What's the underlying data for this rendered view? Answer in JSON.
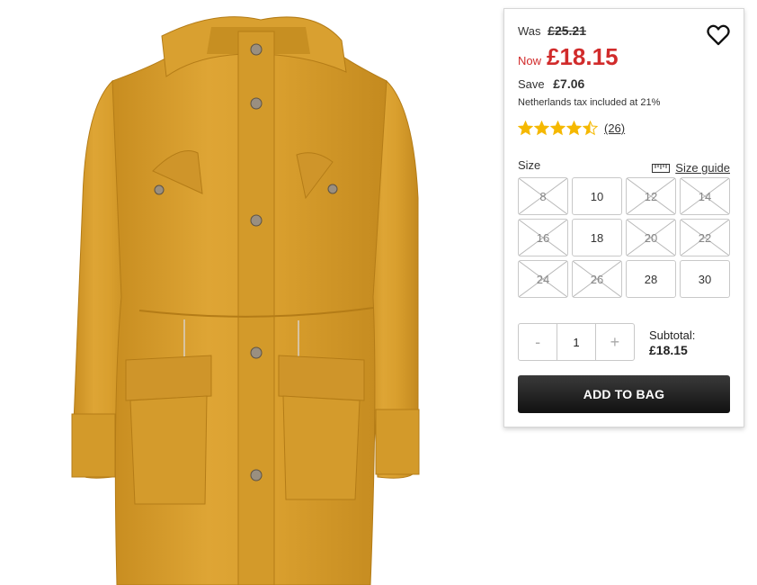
{
  "product": {
    "image_alt": "Mustard yellow hooded parka coat",
    "colors": {
      "coat": "#d79f2c",
      "coat_dark": "#b7801b",
      "coat_light": "#e8b84a"
    }
  },
  "price": {
    "was_label": "Was",
    "was_value": "£25.21",
    "now_label": "Now",
    "now_value": "£18.15",
    "save_label": "Save",
    "save_value": "£7.06",
    "tax_note": "Netherlands tax included at 21%",
    "accent": "#d12b2b"
  },
  "rating": {
    "stars": 4.5,
    "max": 5,
    "count_text": "(26)",
    "star_color": "#f5b800"
  },
  "size": {
    "label": "Size",
    "guide_label": "Size guide",
    "options": [
      {
        "label": "8",
        "available": false
      },
      {
        "label": "10",
        "available": true
      },
      {
        "label": "12",
        "available": false
      },
      {
        "label": "14",
        "available": false
      },
      {
        "label": "16",
        "available": false
      },
      {
        "label": "18",
        "available": true
      },
      {
        "label": "20",
        "available": false
      },
      {
        "label": "22",
        "available": false
      },
      {
        "label": "24",
        "available": false
      },
      {
        "label": "26",
        "available": false
      },
      {
        "label": "28",
        "available": true
      },
      {
        "label": "30",
        "available": true
      }
    ]
  },
  "quantity": {
    "minus": "-",
    "value": "1",
    "plus": "+"
  },
  "subtotal": {
    "label": "Subtotal:",
    "value": "£18.15"
  },
  "actions": {
    "add_to_bag": "ADD TO BAG",
    "wishlist_icon": "heart-icon"
  }
}
